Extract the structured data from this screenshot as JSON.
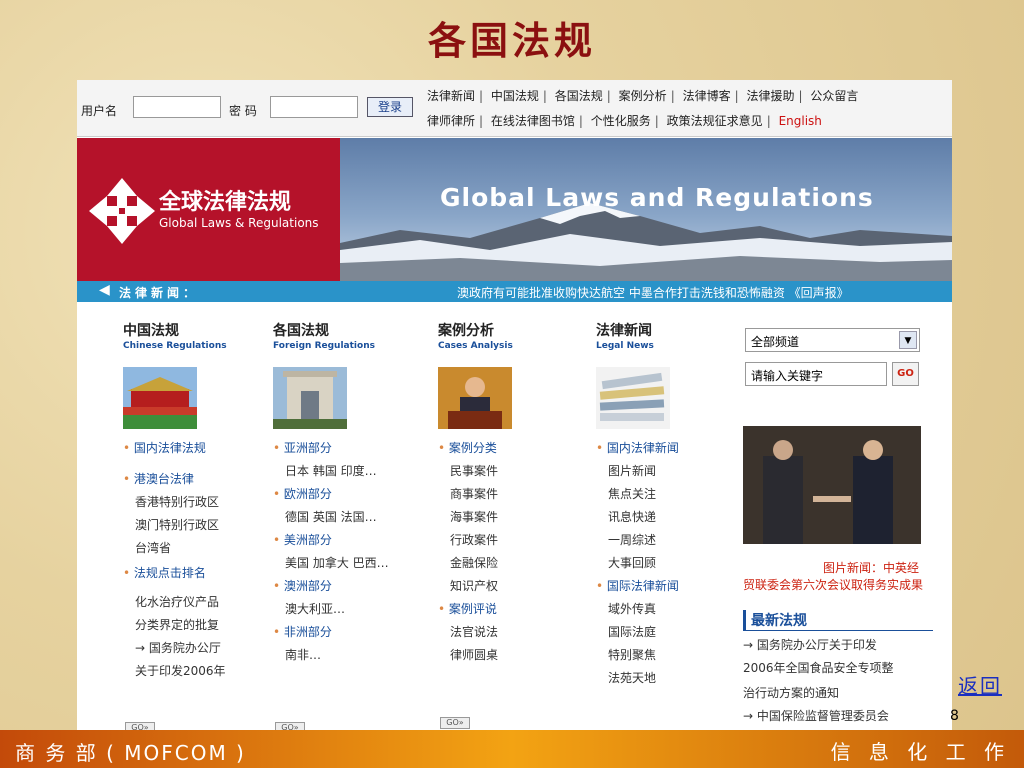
{
  "slide_title": "各国法规",
  "topbar": {
    "username_label": "用户名",
    "password_label": "密 码",
    "login_button": "登录",
    "nav_row1": [
      "法律新闻",
      "中国法规",
      "各国法规",
      "案例分析",
      "法律博客",
      "法律援助",
      "公众留言"
    ],
    "nav_row2": [
      "律师律所",
      "在线法律图书馆",
      "个性化服务",
      "政策法规征求意见",
      "English"
    ]
  },
  "banner": {
    "logo_cn": "全球法律法规",
    "logo_en": "Global Laws & Regulations",
    "headline": "Global Laws and Regulations"
  },
  "ticker": {
    "label": "法律新闻：",
    "text": "澳政府有可能批准收购快达航空 中墨合作打击洗钱和恐怖融资 《回声报》"
  },
  "columns": [
    {
      "title": "中国法规",
      "subtitle": "Chinese Regulations",
      "entries": [
        {
          "type": "link",
          "text": "国内法律法规"
        },
        {
          "type": "link",
          "text": "港澳台法律"
        },
        {
          "type": "item",
          "text": "香港特别行政区"
        },
        {
          "type": "item",
          "text": "澳门特别行政区"
        },
        {
          "type": "item",
          "text": "台湾省"
        },
        {
          "type": "link",
          "text": "法规点击排名"
        },
        {
          "type": "item",
          "text": "化水治疗仪产品"
        },
        {
          "type": "item",
          "text": "分类界定的批复"
        },
        {
          "type": "item",
          "text": "→ 国务院办公厅"
        },
        {
          "type": "item",
          "text": "关于印发2006年"
        }
      ]
    },
    {
      "title": "各国法规",
      "subtitle": "Foreign Regulations",
      "entries": [
        {
          "type": "link",
          "text": "亚洲部分"
        },
        {
          "type": "item",
          "text": "日本 韩国 印度…"
        },
        {
          "type": "link",
          "text": "欧洲部分"
        },
        {
          "type": "item",
          "text": "德国 英国 法国…"
        },
        {
          "type": "link",
          "text": "美洲部分"
        },
        {
          "type": "item",
          "text": "美国 加拿大 巴西…"
        },
        {
          "type": "link",
          "text": "澳洲部分"
        },
        {
          "type": "item",
          "text": "澳大利亚…"
        },
        {
          "type": "link",
          "text": "非洲部分"
        },
        {
          "type": "item",
          "text": "南非…"
        }
      ]
    },
    {
      "title": "案例分析",
      "subtitle": "Cases Analysis",
      "entries": [
        {
          "type": "link",
          "text": "案例分类"
        },
        {
          "type": "item",
          "text": "民事案件"
        },
        {
          "type": "item",
          "text": "商事案件"
        },
        {
          "type": "item",
          "text": "海事案件"
        },
        {
          "type": "item",
          "text": "行政案件"
        },
        {
          "type": "item",
          "text": "金融保险"
        },
        {
          "type": "item",
          "text": "知识产权"
        },
        {
          "type": "link",
          "text": "案例评说"
        },
        {
          "type": "item",
          "text": "法官说法"
        },
        {
          "type": "item",
          "text": "律师圆桌"
        }
      ]
    },
    {
      "title": "法律新闻",
      "subtitle": "Legal News",
      "entries": [
        {
          "type": "link",
          "text": "国内法律新闻"
        },
        {
          "type": "item",
          "text": "图片新闻"
        },
        {
          "type": "item",
          "text": "焦点关注"
        },
        {
          "type": "item",
          "text": "讯息快递"
        },
        {
          "type": "item",
          "text": "一周综述"
        },
        {
          "type": "item",
          "text": "大事回顾"
        },
        {
          "type": "link",
          "text": "国际法律新闻"
        },
        {
          "type": "item",
          "text": "域外传真"
        },
        {
          "type": "item",
          "text": "国际法庭"
        },
        {
          "type": "item",
          "text": "特别聚焦"
        },
        {
          "type": "item",
          "text": "法苑天地"
        }
      ]
    }
  ],
  "go_label": "GO»",
  "sidebar": {
    "channel_select": "全部频道",
    "keyword_placeholder": "请输入关键字",
    "search_button": "GO",
    "photo_news_label": "图片新闻：",
    "photo_news_text": "图片新闻：中英经贸联委会第六次会议取得务实成果",
    "latest_laws_heading": "最新法规",
    "latest_laws": [
      "→ 国务院办公厅关于印发",
      "2006年全国食品安全专项整",
      "治行动方案的通知",
      "→ 中国保险监督管理委员会"
    ]
  },
  "footer": {
    "left": "商 务 部 ( MOFCOM )",
    "right": "信 息 化 工 作"
  },
  "back_link": "返回",
  "page_number": "8"
}
